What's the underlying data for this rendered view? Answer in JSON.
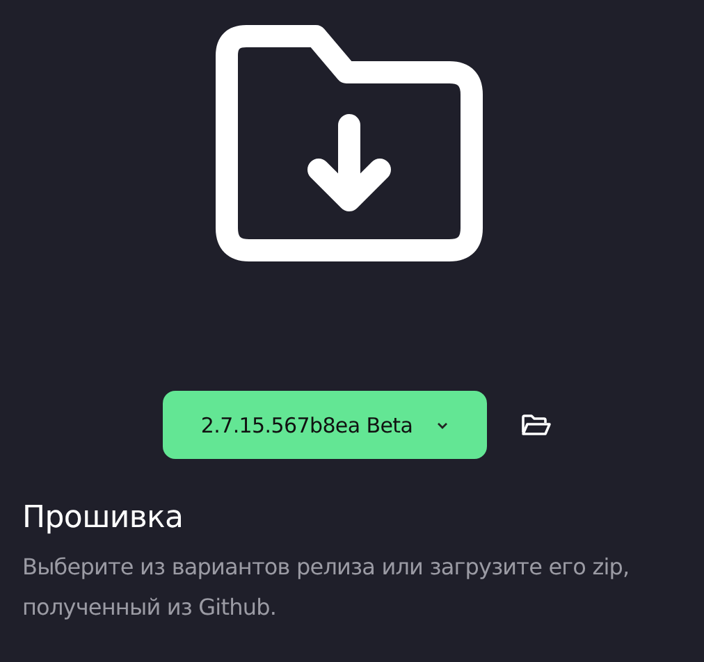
{
  "version_select": {
    "value": "2.7.15.567b8ea Beta"
  },
  "title": "Прошивка",
  "description": "Выберите из вариантов релиза или загрузите его zip, полученный из Github."
}
